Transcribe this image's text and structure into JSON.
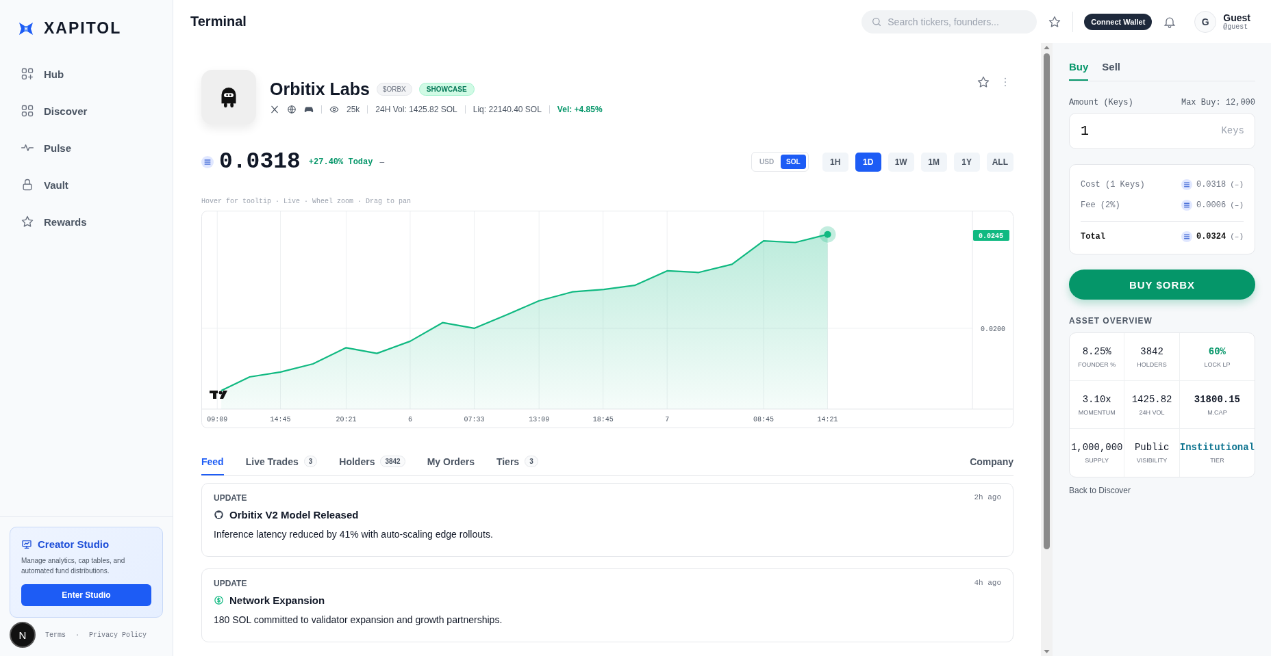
{
  "brand": {
    "name": "XAPITOL"
  },
  "nav": [
    {
      "kind": "hub",
      "label": "Hub"
    },
    {
      "kind": "grid",
      "label": "Discover"
    },
    {
      "kind": "pulse",
      "label": "Pulse"
    },
    {
      "kind": "lock",
      "label": "Vault"
    },
    {
      "kind": "star",
      "label": "Rewards"
    }
  ],
  "creator_studio": {
    "title": "Creator Studio",
    "description": "Manage analytics, cap tables, and automated fund distributions.",
    "button": "Enter Studio"
  },
  "footer_links": [
    "Terms",
    "Privacy Policy"
  ],
  "footer_separator": "·",
  "dev_badge": "N",
  "header": {
    "title": "Terminal",
    "search": {
      "placeholder": "Search tickers, founders..."
    },
    "connect_button": "Connect Wallet",
    "user": {
      "initial": "G",
      "name": "Guest",
      "handle": "@guest"
    }
  },
  "asset": {
    "name": "Orbitix Labs",
    "ticker": "$ORBX",
    "badge": "SHOWCASE",
    "views": "25k",
    "stats": [
      {
        "text": "24H Vol: 1425.82 SOL",
        "positive": false
      },
      {
        "text": "Liq: 22140.40 SOL",
        "positive": false
      },
      {
        "text": "Vel: +4.85%",
        "positive": true
      }
    ]
  },
  "price": {
    "value": "0.0318",
    "change": "+27.40% Today",
    "suffix": "–"
  },
  "currency": [
    {
      "label": "USD",
      "selected": false
    },
    {
      "label": "SOL",
      "selected": true
    }
  ],
  "ranges": [
    {
      "label": "1H",
      "selected": false
    },
    {
      "label": "1D",
      "selected": true
    },
    {
      "label": "1W",
      "selected": false
    },
    {
      "label": "1M",
      "selected": false
    },
    {
      "label": "1Y",
      "selected": false
    },
    {
      "label": "ALL",
      "selected": false
    }
  ],
  "chart": {
    "hint": "Hover for tooltip · Live · Wheel zoom · Drag to pan",
    "y_label": "0.0200",
    "price_tag": "0.0245",
    "x_labels": [
      "09:09",
      "14:45",
      "20:21",
      "6",
      "07:33",
      "13:09",
      "18:45",
      "7",
      "08:45",
      "14:21"
    ]
  },
  "tabs": [
    {
      "label": "Feed",
      "selected": true
    },
    {
      "label": "Live Trades",
      "count": "3",
      "selected": false
    },
    {
      "label": "Holders",
      "count": "3842",
      "selected": false
    },
    {
      "label": "My Orders",
      "selected": false
    },
    {
      "label": "Tiers",
      "count": "3",
      "selected": false
    }
  ],
  "company_tab": "Company",
  "feed": [
    {
      "kind": "github",
      "category": "UPDATE",
      "time": "2h ago",
      "title": "Orbitix V2 Model Released",
      "body": "Inference latency reduced by 41% with auto-scaling edge rollouts."
    },
    {
      "kind": "coin",
      "category": "UPDATE",
      "time": "4h ago",
      "title": "Network Expansion",
      "body": "180 SOL committed to validator expansion and growth partnerships."
    }
  ],
  "trade": {
    "tabs": [
      {
        "label": "Buy",
        "selected": true
      },
      {
        "label": "Sell",
        "selected": false
      }
    ],
    "amount_label": "Amount (Keys)",
    "max_buy": "Max Buy: 12,000",
    "amount": "1",
    "unit": "Keys",
    "lines": [
      {
        "label": "Cost (1 Keys)",
        "value": "0.0318",
        "note": "(–)",
        "total": false
      },
      {
        "label": "Fee (2%)",
        "value": "0.0006",
        "note": "(–)",
        "total": false
      },
      {
        "label": "Total",
        "value": "0.0324",
        "note": "(–)",
        "total": true
      }
    ],
    "button": "BUY $ORBX"
  },
  "overview": {
    "title": "ASSET OVERVIEW",
    "cells": [
      {
        "value": "8.25%",
        "label": "FOUNDER %",
        "color": "#111827"
      },
      {
        "value": "3842",
        "label": "HOLDERS",
        "color": "#111827"
      },
      {
        "value": "60%",
        "label": "LOCK LP",
        "color": "#059669"
      },
      {
        "value": "3.10x",
        "label": "MOMENTUM",
        "color": "#111827"
      },
      {
        "value": "1425.82",
        "label": "24H VOL",
        "color": "#111827"
      },
      {
        "value": "31800.15",
        "label": "M.CAP",
        "color": "#111827"
      },
      {
        "value": "1,000,000",
        "label": "SUPPLY",
        "color": "#111827"
      },
      {
        "value": "Public",
        "label": "VISIBILITY",
        "color": "#111827"
      },
      {
        "value": "Institutional",
        "label": "TIER",
        "color": "#0e7490"
      }
    ],
    "back_link": "Back to Discover"
  }
}
